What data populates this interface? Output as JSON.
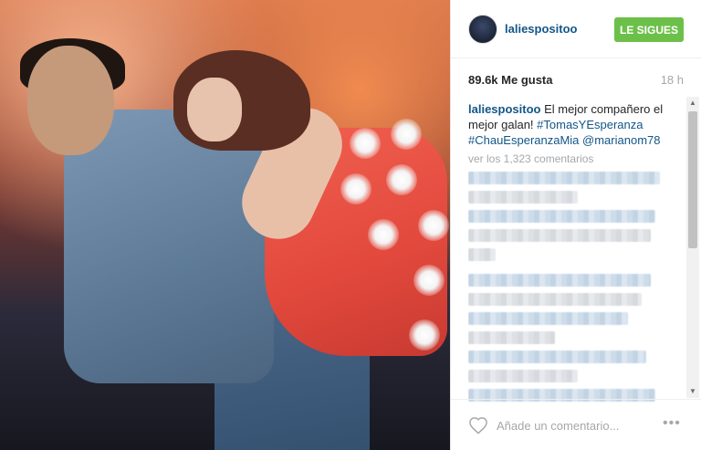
{
  "post": {
    "username": "laliespositoo",
    "follow_button_label": "LE SIGUES",
    "likes": "89.6k Me gusta",
    "time": "18 h"
  },
  "caption": {
    "username": "laliespositoo",
    "text": " El mejor compañero el mejor galan! ",
    "tags": [
      "#TomasYEsperanza",
      "#ChauEsperanzaMia",
      "@marianom78"
    ]
  },
  "comments": {
    "load_more": "ver los 1,323 comentarios"
  },
  "footer": {
    "comment_placeholder": "Añade un comentario...",
    "more_icon": "•••"
  },
  "icons": {
    "heart": "heart-outline-icon",
    "more": "ellipsis-icon",
    "scroll_up": "▲",
    "scroll_down": "▼"
  },
  "colors": {
    "follow_button": "#6cc04a",
    "link_blue": "#125688",
    "muted_text": "#a5a7aa"
  }
}
